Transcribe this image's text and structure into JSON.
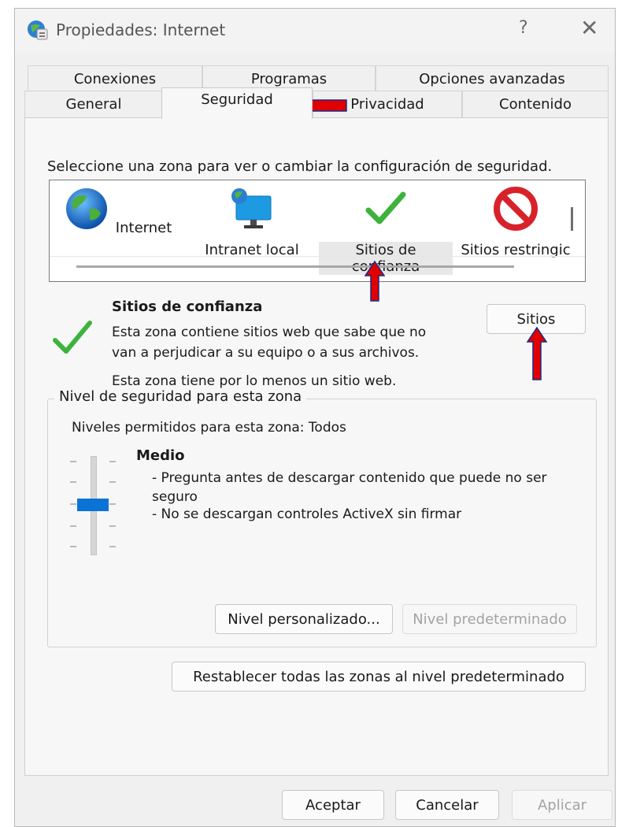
{
  "window": {
    "title": "Propiedades: Internet",
    "help_glyph": "?",
    "close_glyph": "✕"
  },
  "tabs": {
    "row1": [
      "Conexiones",
      "Programas",
      "Opciones avanzadas"
    ],
    "row2": [
      "General",
      "Seguridad",
      "Privacidad",
      "Contenido"
    ],
    "active": "Seguridad"
  },
  "security": {
    "zone_prompt": "Seleccione una zona para ver o cambiar la configuración de seguridad.",
    "zones": [
      {
        "label": "Internet",
        "icon": "globe-icon"
      },
      {
        "label": "Intranet local",
        "icon": "monitor-globe-icon"
      },
      {
        "label": "Sitios de confianza",
        "icon": "checkmark-icon"
      },
      {
        "label": "Sitios restringic",
        "icon": "prohibited-icon"
      }
    ],
    "selected_zone": "Sitios de confianza",
    "zone_detail": {
      "title": "Sitios de confianza",
      "description_line1": "Esta zona contiene sitios web que sabe que no",
      "description_line2": "van a perjudicar a su equipo o a sus archivos.",
      "count_text": "Esta zona tiene por lo menos un sitio web.",
      "sites_button": "Sitios"
    },
    "level_group": {
      "legend": "Nivel de seguridad para esta zona",
      "allowed": "Niveles permitidos para esta zona: Todos",
      "level_name": "Medio",
      "bullet1_line1": "- Pregunta antes de descargar contenido que puede no ser",
      "bullet1_line2": "seguro",
      "bullet2": "- No se descargan controles ActiveX sin firmar",
      "custom_button": "Nivel personalizado...",
      "default_button": "Nivel predeterminado",
      "slider_level": 0.5
    },
    "reset_button": "Restablecer todas las zonas al nivel predeterminado"
  },
  "footer": {
    "ok": "Aceptar",
    "cancel": "Cancelar",
    "apply": "Aplicar"
  },
  "colors": {
    "accent": "#0a74d6",
    "annotation_arrow": "#e00000",
    "checkmark": "#3db33d",
    "prohibited": "#d8222a"
  }
}
